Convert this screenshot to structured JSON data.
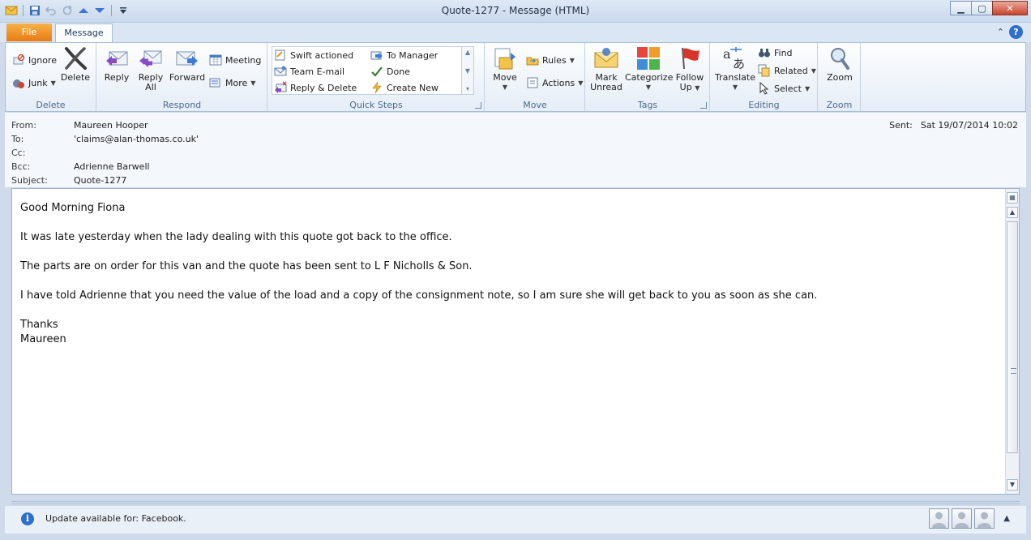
{
  "window": {
    "title": "Quote-1277  -  Message (HTML)",
    "min_glyph": "▁",
    "max_glyph": "▢",
    "close_glyph": "✕"
  },
  "tabs": {
    "file": "File",
    "message": "Message"
  },
  "help": {
    "collapse_glyph": "⌃",
    "help_glyph": "?"
  },
  "ribbon": {
    "delete": {
      "label": "Delete",
      "ignore": "Ignore",
      "junk": "Junk",
      "delete": "Delete"
    },
    "respond": {
      "label": "Respond",
      "reply": "Reply",
      "reply_all_1": "Reply",
      "reply_all_2": "All",
      "forward": "Forward",
      "meeting": "Meeting",
      "more": "More"
    },
    "quick_steps": {
      "label": "Quick Steps",
      "items": [
        "Swift actioned",
        "Team E-mail",
        "Reply & Delete",
        "To Manager",
        "Done",
        "Create New"
      ]
    },
    "move": {
      "label": "Move",
      "move": "Move",
      "rules": "Rules",
      "actions": "Actions"
    },
    "tags": {
      "label": "Tags",
      "mark_unread_1": "Mark",
      "mark_unread_2": "Unread",
      "categorize": "Categorize",
      "follow_up_1": "Follow",
      "follow_up_2": "Up"
    },
    "editing": {
      "label": "Editing",
      "translate": "Translate",
      "find": "Find",
      "related": "Related",
      "select": "Select"
    },
    "zoom": {
      "label": "Zoom",
      "zoom": "Zoom"
    }
  },
  "headers": {
    "from_label": "From:",
    "from": "Maureen Hooper",
    "to_label": "To:",
    "to": "'claims@alan-thomas.co.uk'",
    "cc_label": "Cc:",
    "cc": "",
    "bcc_label": "Bcc:",
    "bcc": "Adrienne Barwell",
    "subject_label": "Subject:",
    "subject": "Quote-1277",
    "sent_label": "Sent:",
    "sent": "Sat 19/07/2014 10:02"
  },
  "body": {
    "greeting": "Good Morning Fiona",
    "p1": "It was late yesterday when the lady dealing with this quote got back to the office.",
    "p2": "The parts are on order for this van and the quote has been sent to L F Nicholls & Son.",
    "p3": "I have told Adrienne that you need the value of the load and a copy of the consignment note, so I am sure she will get back to you as soon as she can.",
    "closing": "Thanks",
    "signature": "Maureen"
  },
  "people_pane": {
    "update_text": "Update available for: Facebook."
  }
}
